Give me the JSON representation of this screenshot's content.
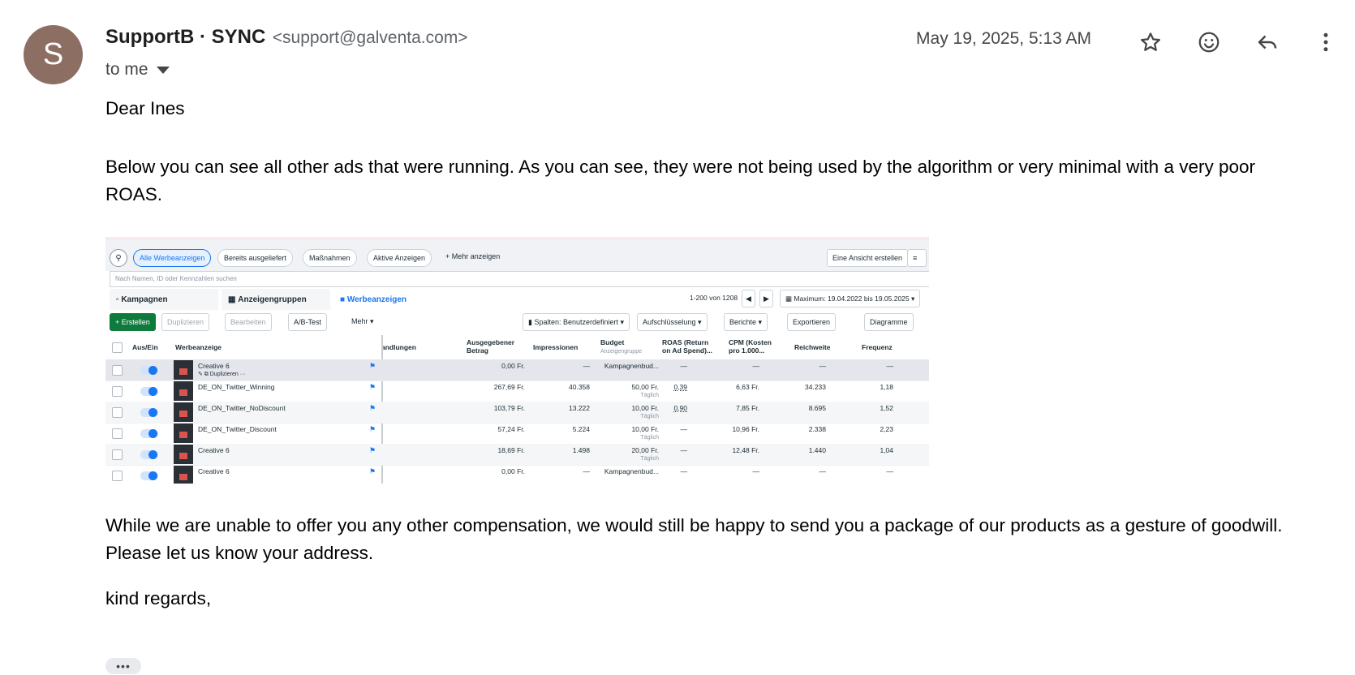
{
  "sender": {
    "avatar_letter": "S",
    "name": "SupportB · SYNC",
    "email": "<support@galventa.com>",
    "to": "to me",
    "date": "May 19, 2025, 5:13 AM"
  },
  "body": {
    "greeting": "Dear Ines",
    "p1": "Below you can see all other ads that were running. As you can see, they were not being used by the algorithm or very minimal with a very poor ROAS.",
    "p2": "While we are unable to offer you any other compensation, we would still be happy to send you a package of our products as a gesture of goodwill. Please let us know your address.",
    "closing": "kind regards,"
  },
  "screenshot": {
    "filters": [
      "Alle Werbeanzeigen",
      "Bereits ausgeliefert",
      "Maßnahmen",
      "Aktive Anzeigen",
      "+ Mehr anzeigen"
    ],
    "create_view": "Eine Ansicht erstellen",
    "search_placeholder": "Nach Namen, ID oder Kennzahlen suchen",
    "tabs": [
      "Kampagnen",
      "Anzeigengruppen",
      "Werbeanzeigen"
    ],
    "pagination": "1-200 von 1208",
    "date_range": "Maximum: 19.04.2022 bis 19.05.2025",
    "toolbar": {
      "create": "+ Erstellen",
      "duplicate": "Duplizieren",
      "edit": "Bearbeiten",
      "abtest": "A/B-Test",
      "more": "Mehr",
      "columns": "Spalten: Benutzerdefiniert",
      "breakdown": "Aufschlüsselung",
      "reports": "Berichte",
      "export": "Exportieren",
      "charts": "Diagramme"
    },
    "headers": {
      "onoff": "Aus/Ein",
      "ad": "Werbeanzeige",
      "actions": "andlungen",
      "spent1": "Ausgegebener",
      "spent2": "Betrag",
      "impressions": "Impressionen",
      "budget": "Budget",
      "budget_sub": "Anzeigengruppe",
      "roas1": "ROAS (Return",
      "roas2": "on Ad Spend)...",
      "cpm1": "CPM (Kosten",
      "cpm2": "pro 1.000...",
      "reach": "Reichweite",
      "freq": "Frequenz"
    },
    "hover_actions": {
      "duplicate": "Duplizieren",
      "more": "···"
    },
    "rows": [
      {
        "name": "Creative 6",
        "spent": "0,00 Fr.",
        "impr": "—",
        "budget": "Kampagnenbud...",
        "budget_sub": "",
        "roas": "—",
        "cpm": "—",
        "reach": "—",
        "freq": "—"
      },
      {
        "name": "DE_ON_Twitter_Winning",
        "spent": "267,69 Fr.",
        "impr": "40.358",
        "budget": "50,00 Fr.",
        "budget_sub": "Täglich",
        "roas": "0,39",
        "cpm": "6,63 Fr.",
        "reach": "34.233",
        "freq": "1,18"
      },
      {
        "name": "DE_ON_Twitter_NoDiscount",
        "spent": "103,79 Fr.",
        "impr": "13.222",
        "budget": "10,00 Fr.",
        "budget_sub": "Täglich",
        "roas": "0,90",
        "cpm": "7,85 Fr.",
        "reach": "8.695",
        "freq": "1,52"
      },
      {
        "name": "DE_ON_Twitter_Discount",
        "spent": "57,24 Fr.",
        "impr": "5.224",
        "budget": "10,00 Fr.",
        "budget_sub": "Täglich",
        "roas": "—",
        "cpm": "10,96 Fr.",
        "reach": "2.338",
        "freq": "2,23"
      },
      {
        "name": "Creative 6",
        "spent": "18,69 Fr.",
        "impr": "1.498",
        "budget": "20,00 Fr.",
        "budget_sub": "Täglich",
        "roas": "—",
        "cpm": "12,48 Fr.",
        "reach": "1.440",
        "freq": "1,04"
      },
      {
        "name": "Creative 6",
        "spent": "0,00 Fr.",
        "impr": "—",
        "budget": "Kampagnenbud...",
        "budget_sub": "",
        "roas": "—",
        "cpm": "—",
        "reach": "—",
        "freq": "—"
      }
    ]
  },
  "icons": [
    "star-icon",
    "emoji-icon",
    "reply-icon",
    "more-vert-icon"
  ],
  "show_trimmed": "•••"
}
